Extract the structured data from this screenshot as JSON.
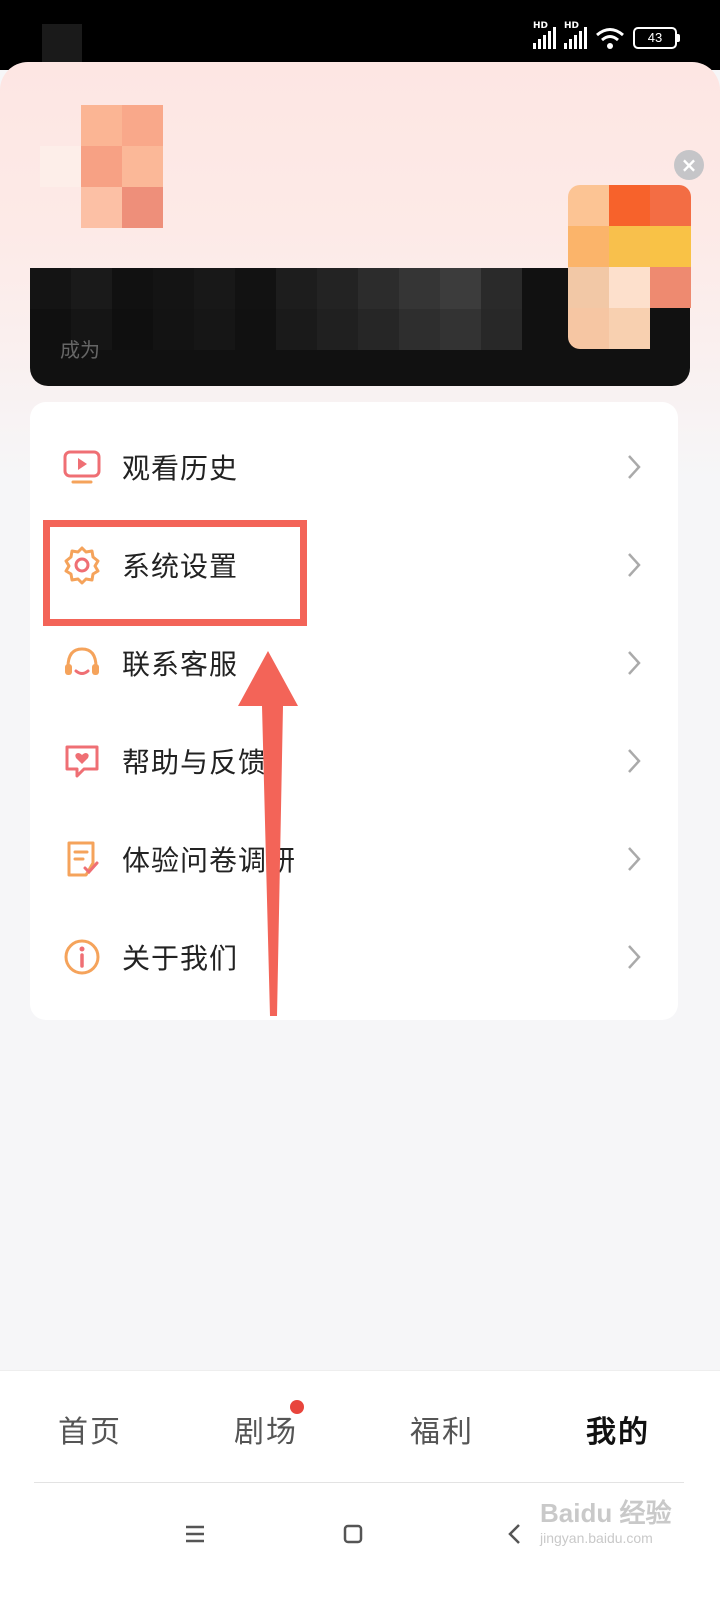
{
  "status_bar": {
    "signal1_label": "HD",
    "signal2_label": "HD",
    "battery": "43"
  },
  "banner": {
    "text": "成为"
  },
  "menu": {
    "items": [
      {
        "label": "观看历史",
        "icon": "tv-play-icon"
      },
      {
        "label": "系统设置",
        "icon": "gear-icon"
      },
      {
        "label": "联系客服",
        "icon": "headset-icon"
      },
      {
        "label": "帮助与反馈",
        "icon": "heart-chat-icon"
      },
      {
        "label": "体验问卷调研",
        "icon": "survey-icon"
      },
      {
        "label": "关于我们",
        "icon": "info-icon"
      }
    ]
  },
  "tabbar": {
    "tabs": [
      {
        "label": "首页"
      },
      {
        "label": "剧场"
      },
      {
        "label": "福利"
      },
      {
        "label": "我的"
      }
    ],
    "active": "我的"
  },
  "watermark": {
    "main": "Baidu 经验",
    "sub": "jingyan.baidu.com"
  },
  "colors": {
    "accent": "#f36458",
    "icon_orange": "#f5a35b",
    "icon_pink": "#ef6f74"
  }
}
